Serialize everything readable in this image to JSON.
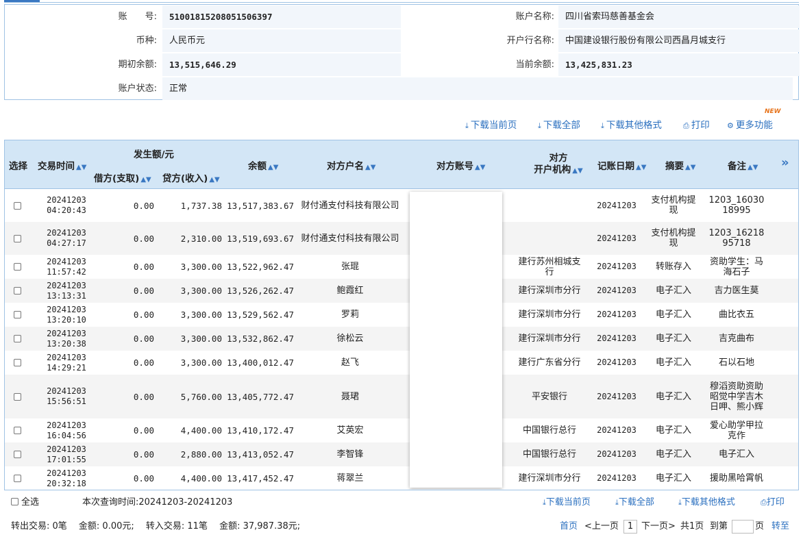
{
  "account": {
    "no_label": "账　　号:",
    "no_value": "51001815208051506397",
    "name_label": "账户名称:",
    "name_value": "四川省索玛慈善基金会",
    "currency_label": "币种:",
    "currency_value": "人民币元",
    "bank_label": "开户行名称:",
    "bank_value": "中国建设银行股份有限公司西昌月城支行",
    "opening_label": "期初余额:",
    "opening_value": "13,515,646.29",
    "current_label": "当前余额:",
    "current_value": "13,425,831.23",
    "status_label": "账户状态:",
    "status_value": "正常"
  },
  "toolbar": {
    "download_page": "下载当前页",
    "download_all": "下载全部",
    "download_other": "下载其他格式",
    "print": "打印",
    "more": "更多功能",
    "new_badge": "NEW"
  },
  "table": {
    "headers": {
      "select": "选择",
      "time": "交易时间",
      "amount_group": "发生额/元",
      "debit": "借方(支取)",
      "credit": "贷方(收入)",
      "balance": "余额",
      "counterparty_name": "对方户名",
      "counterparty_account": "对方账号",
      "counterparty_bank_1": "对方",
      "counterparty_bank_2": "开户机构",
      "post_date": "记账日期",
      "summary": "摘要",
      "note": "备注",
      "more_cols": "»"
    },
    "rows": [
      {
        "date": "20241203",
        "time": "04:20:43",
        "debit": "0.00",
        "credit": "1,737.38",
        "balance": "13,517,383.67",
        "name": "财付通支付科技有限公司",
        "bank": "",
        "post": "20241203",
        "summary": "支付机构提现",
        "note": "1203_1603018995"
      },
      {
        "date": "20241203",
        "time": "04:27:17",
        "debit": "0.00",
        "credit": "2,310.00",
        "balance": "13,519,693.67",
        "name": "财付通支付科技有限公司",
        "bank": "",
        "post": "20241203",
        "summary": "支付机构提现",
        "note": "1203_1621895718"
      },
      {
        "date": "20241203",
        "time": "11:57:42",
        "debit": "0.00",
        "credit": "3,300.00",
        "balance": "13,522,962.47",
        "name": "张琨",
        "bank": "建行苏州相城支行",
        "post": "20241203",
        "summary": "转账存入",
        "note": "资助学生：马海石子"
      },
      {
        "date": "20241203",
        "time": "13:13:31",
        "debit": "0.00",
        "credit": "3,300.00",
        "balance": "13,526,262.47",
        "name": "鲍霞红",
        "bank": "建行深圳市分行",
        "post": "20241203",
        "summary": "电子汇入",
        "note": "吉力医生莫"
      },
      {
        "date": "20241203",
        "time": "13:20:10",
        "debit": "0.00",
        "credit": "3,300.00",
        "balance": "13,529,562.47",
        "name": "罗莉",
        "bank": "建行深圳市分行",
        "post": "20241203",
        "summary": "电子汇入",
        "note": "曲比衣五"
      },
      {
        "date": "20241203",
        "time": "13:20:38",
        "debit": "0.00",
        "credit": "3,300.00",
        "balance": "13,532,862.47",
        "name": "徐松云",
        "bank": "建行深圳市分行",
        "post": "20241203",
        "summary": "电子汇入",
        "note": "吉克曲布"
      },
      {
        "date": "20241203",
        "time": "14:29:21",
        "debit": "0.00",
        "credit": "3,300.00",
        "balance": "13,400,012.47",
        "name": "赵飞",
        "bank": "建行广东省分行",
        "post": "20241203",
        "summary": "电子汇入",
        "note": "石以石地"
      },
      {
        "date": "20241203",
        "time": "15:56:51",
        "debit": "0.00",
        "credit": "5,760.00",
        "balance": "13,405,772.47",
        "name": "聂珺",
        "bank": "平安银行",
        "post": "20241203",
        "summary": "电子汇入",
        "note": "穆滔资助资助昭觉中学吉木日呷、熊小辉"
      },
      {
        "date": "20241203",
        "time": "16:04:56",
        "debit": "0.00",
        "credit": "4,400.00",
        "balance": "13,410,172.47",
        "name": "艾英宏",
        "bank": "中国银行总行",
        "post": "20241203",
        "summary": "电子汇入",
        "note": "爱心助学甲拉克作"
      },
      {
        "date": "20241203",
        "time": "17:01:55",
        "debit": "0.00",
        "credit": "2,880.00",
        "balance": "13,413,052.47",
        "name": "李智锋",
        "bank": "中国银行总行",
        "post": "20241203",
        "summary": "电子汇入",
        "note": "电子汇入"
      },
      {
        "date": "20241203",
        "time": "20:32:18",
        "debit": "0.00",
        "credit": "4,400.00",
        "balance": "13,417,452.47",
        "name": "蒋翠兰",
        "bank": "建行深圳市分行",
        "post": "20241203",
        "summary": "电子汇入",
        "note": "援助黑哈霄帆"
      }
    ]
  },
  "footer": {
    "select_all": "全选",
    "query_time": "本次查询时间:20241203-20241203",
    "download_page": "下载当前页",
    "download_all": "下载全部",
    "download_other": "下载其他格式",
    "print": "打印",
    "summary": "转出交易: 0笔　 金额: 0.00元;　 转入交易: 11笔　 金额: 37,987.38元;",
    "first": "首页",
    "prev": "<上一页",
    "page_current": "1",
    "next": "下一页>",
    "total": "共1页",
    "goto_prefix": "到第",
    "goto_suffix": "页",
    "goto": "转至"
  }
}
